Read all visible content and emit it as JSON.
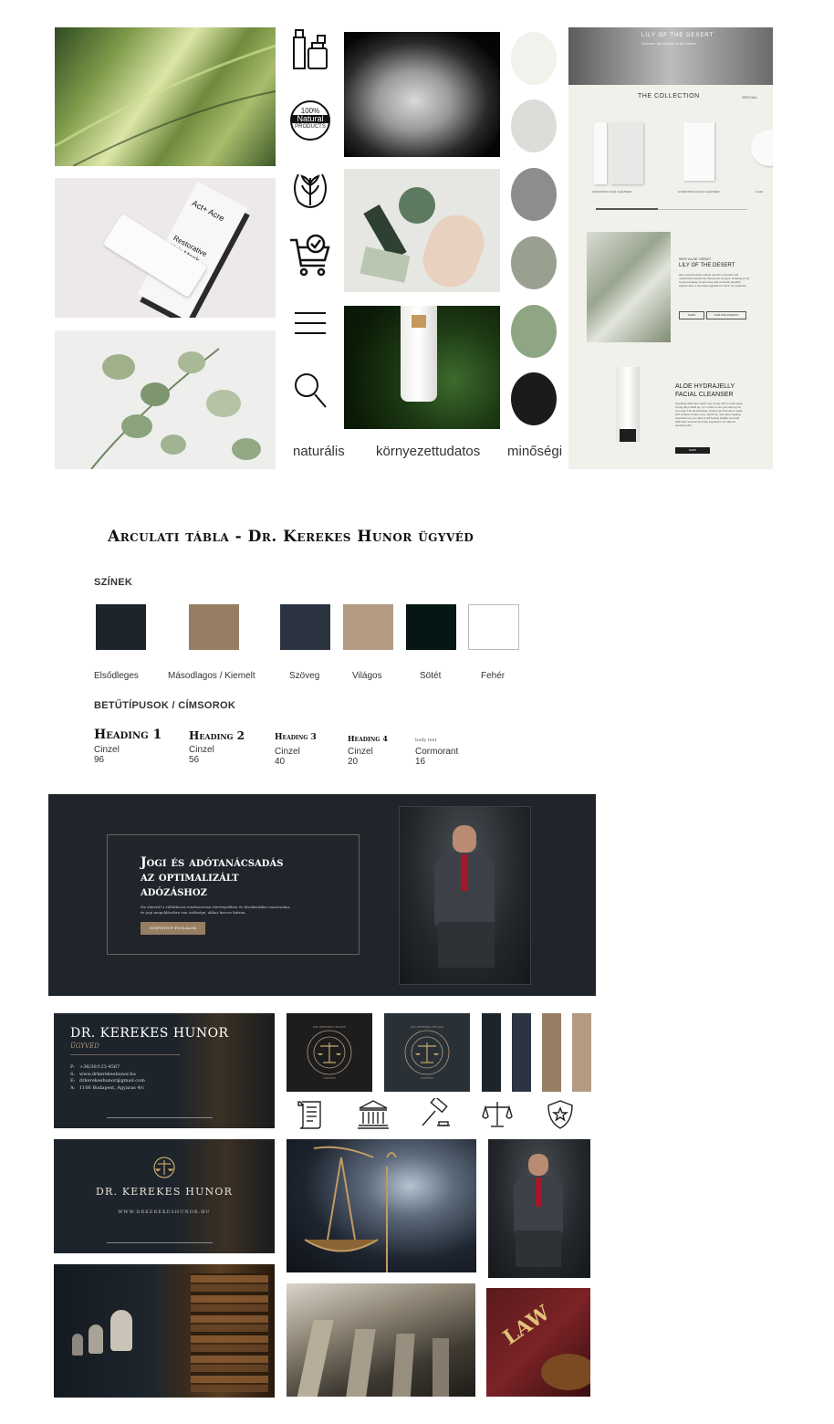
{
  "moodboard": {
    "value_words": [
      "naturális",
      "környezettudatos",
      "minőségi"
    ],
    "badge": {
      "line1": "100%",
      "line2": "Natural",
      "line3": "PRODUCTS"
    },
    "product_box": {
      "brand": "Act+ Acre",
      "name": "Restorative Hair Mask"
    },
    "palette": [
      "#f2f1eb",
      "#dcdcd8",
      "#8d8d8d",
      "#9aa08f",
      "#8ea683",
      "#1b1b1b"
    ],
    "icons": [
      "skincare-products-icon",
      "natural-badge-icon",
      "leaf-icon",
      "cart-check-icon",
      "menu-icon",
      "search-icon"
    ],
    "web": {
      "hero_title": "LILY OF THE DESERT",
      "hero_sub": "Discover the secrets of the desert",
      "collection": "THE COLLECTION",
      "collection_link": "SPECIAL",
      "products": [
        "HYDRATING FACE CLEANSER",
        "HYDRATING FACIAL CLEANSER",
        "ALOE"
      ],
      "why_kicker": "WHY ALOE VERA?",
      "why_title": "LILY OF THE DESERT",
      "why_text": "Aloe vera has been widely used for cosmetic and medicinal purposes for thousands of years. Drawing on its ancient healing components and cosmetic benefits, organic aloe is the base ingredient in all of our products.",
      "btn1": "SHOP",
      "btn2": "OUR PHILOSOPHY",
      "feature_title_1": "ALOE HYDRAJELLY",
      "feature_title_2": "FACIAL CLEANSER",
      "feature_text": "A healing daily face wash: use on dry skin to work away a long day's build up, or in order to set your skin up for your day. The all-botanical, creamy gel formula is made with a blend of aloe vera, vitamin E, and other healing properties so your face is left feeling healthy and soft. With Aloe Vera as the main ingredient, it's safe for sensitive skin.",
      "feature_btn": "SHOP"
    }
  },
  "brand_board": {
    "title": "Arculati tábla - Dr. Kerekes Hunor ügyvéd",
    "colors_heading": "SZÍNEK",
    "colors": [
      {
        "label": "Elsődleges",
        "hex": "#1d242b"
      },
      {
        "label": "Másodlagos / Kiemelt",
        "hex": "#977e63"
      },
      {
        "label": "Szöveg",
        "hex": "#2b3440"
      },
      {
        "label": "Világos",
        "hex": "#b39a82"
      },
      {
        "label": "Sötét",
        "hex": "#051614"
      },
      {
        "label": "Fehér",
        "hex": "#ffffff"
      }
    ],
    "fonts_heading": "BETŰTÍPUSOK / CÍMSOROK",
    "headings": [
      {
        "sample": "Heading 1",
        "font": "Cinzel",
        "size": "96"
      },
      {
        "sample": "Heading 2",
        "font": "Cinzel",
        "size": "56"
      },
      {
        "sample": "Heading 3",
        "font": "Cinzel",
        "size": "40"
      },
      {
        "sample": "Heading 4",
        "font": "Cinzel",
        "size": "20"
      },
      {
        "sample": "body text",
        "font": "Cormorant",
        "size": "16"
      }
    ]
  },
  "hero_banner": {
    "title_line1": "Jogi és adótanácsadás",
    "title_line2": "az optimalizált",
    "title_line3": "adózáshoz",
    "text_line1": "Ha elmerül a vállalkozói rendszeresen törvényekben és bürokratikus tanácsokra,",
    "text_line2": "és jogi megoldásokra van szüksége, akkor keress bátran.",
    "cta": "Időpontot foglalok"
  },
  "business_card": {
    "name": "DR. KEREKES HUNOR",
    "role": "ÜGYVÉD",
    "contacts": [
      {
        "key": "P:",
        "value": "+36/30/123-4567"
      },
      {
        "key": "S:",
        "value": "www.drkerekeshunor.hu"
      },
      {
        "key": "E:",
        "value": "drkerekeshunor@gmail.com"
      },
      {
        "key": "A:",
        "value": "1106 Budapest, Agyaras 4/c"
      }
    ],
    "back_name": "DR. KEREKES HUNOR",
    "back_url": "WWW.DRKEREKESHUNOR.HU"
  },
  "logo_badge": {
    "ring_top": "DR. KEREKES HUNOR",
    "ring_bottom": "ÜGYVÉD"
  },
  "stripe_colors": [
    "#1d242b",
    "#2b3440",
    "#977e63",
    "#b39a82"
  ],
  "law_icons": [
    "scroll-icon",
    "courthouse-icon",
    "gavel-icon",
    "scales-icon",
    "shield-star-icon"
  ],
  "book_label": "LAW"
}
